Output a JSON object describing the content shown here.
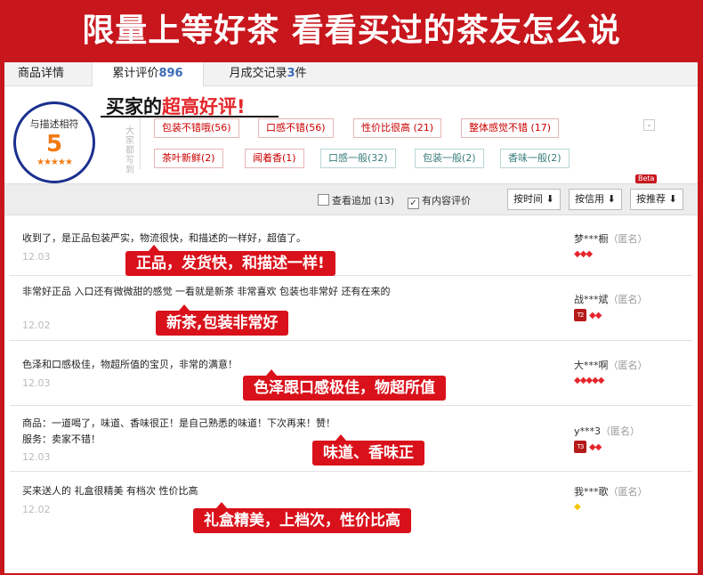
{
  "banner": "限量上等好茶 看看买过的茶友怎么说",
  "tabs": {
    "details": "商品详情",
    "reviews_label": "累计评价",
    "reviews_count": "896",
    "sales_label": "月成交记录",
    "sales_count": "3",
    "sales_unit": "件"
  },
  "rating": {
    "label": "与描述相符",
    "score": "5",
    "stars": "★★★★★"
  },
  "hint": {
    "prefix": "买家的",
    "highlight": "超高好评!"
  },
  "side_label": "大家都写到",
  "tags": {
    "t1": "包装不错哦(56)",
    "t2": "口感不错(56)",
    "t3": "性价比很高 (21)",
    "t4": "整体感觉不错 (17)",
    "t5": "茶叶新鲜(2)",
    "t6": "闻着香(1)",
    "t7": "口感一般(32)",
    "t8": "包装一般(2)",
    "t9": "香味一般(2)"
  },
  "toolbar": {
    "append_label": "查看追加 (13)",
    "content_label": "有内容评价",
    "sort_time": "按时间",
    "sort_credit": "按信用",
    "sort_recommend": "按推荐",
    "beta": "Beta"
  },
  "reviews": {
    "r1": {
      "text": "收到了，是正品包装严实，物流很快，和描述的一样好，超值了。",
      "date": "12.03",
      "user": "梦***橱",
      "anon": "（匿名）",
      "callout": "正品，发货快，和描述一样!"
    },
    "r2": {
      "text": "非常好正品 入口还有微微甜的感觉 一看就是新茶 非常喜欢 包装也非常好 还有在来的",
      "date": "12.02",
      "user": "战***斌",
      "anon": "（匿名）",
      "callout": "新茶,包装非常好"
    },
    "r3": {
      "text": "色泽和口感极佳，物超所值的宝贝，非常的满意！",
      "date": "12.03",
      "user": "大***啊",
      "anon": "（匿名）",
      "callout": "色泽跟口感极佳，物超所值"
    },
    "r4": {
      "text": "商品：一道喝了，味道、香味很正！是自己熟悉的味道！下次再来！赞！",
      "text2": "服务：卖家不错！",
      "date": "12.03",
      "user": "y***3",
      "anon": "（匿名）",
      "callout": "味道、香味正"
    },
    "r5": {
      "text": "买来送人的 礼盒很精美 有档次 性价比高",
      "date": "12.02",
      "user": "我***歌",
      "anon": "（匿名）",
      "callout": "礼盒精美，上档次，性价比高"
    }
  },
  "badges": {
    "red": "◆◆◆",
    "red2": "◆◆",
    "red5": "◆◆◆◆◆",
    "tmall_t2": "T2",
    "tmall_t3": "T3",
    "gold": "◆"
  },
  "colors": {
    "accent": "#c8161d",
    "tag_border": "#e7b4b4",
    "link": "#3c6cb8"
  }
}
